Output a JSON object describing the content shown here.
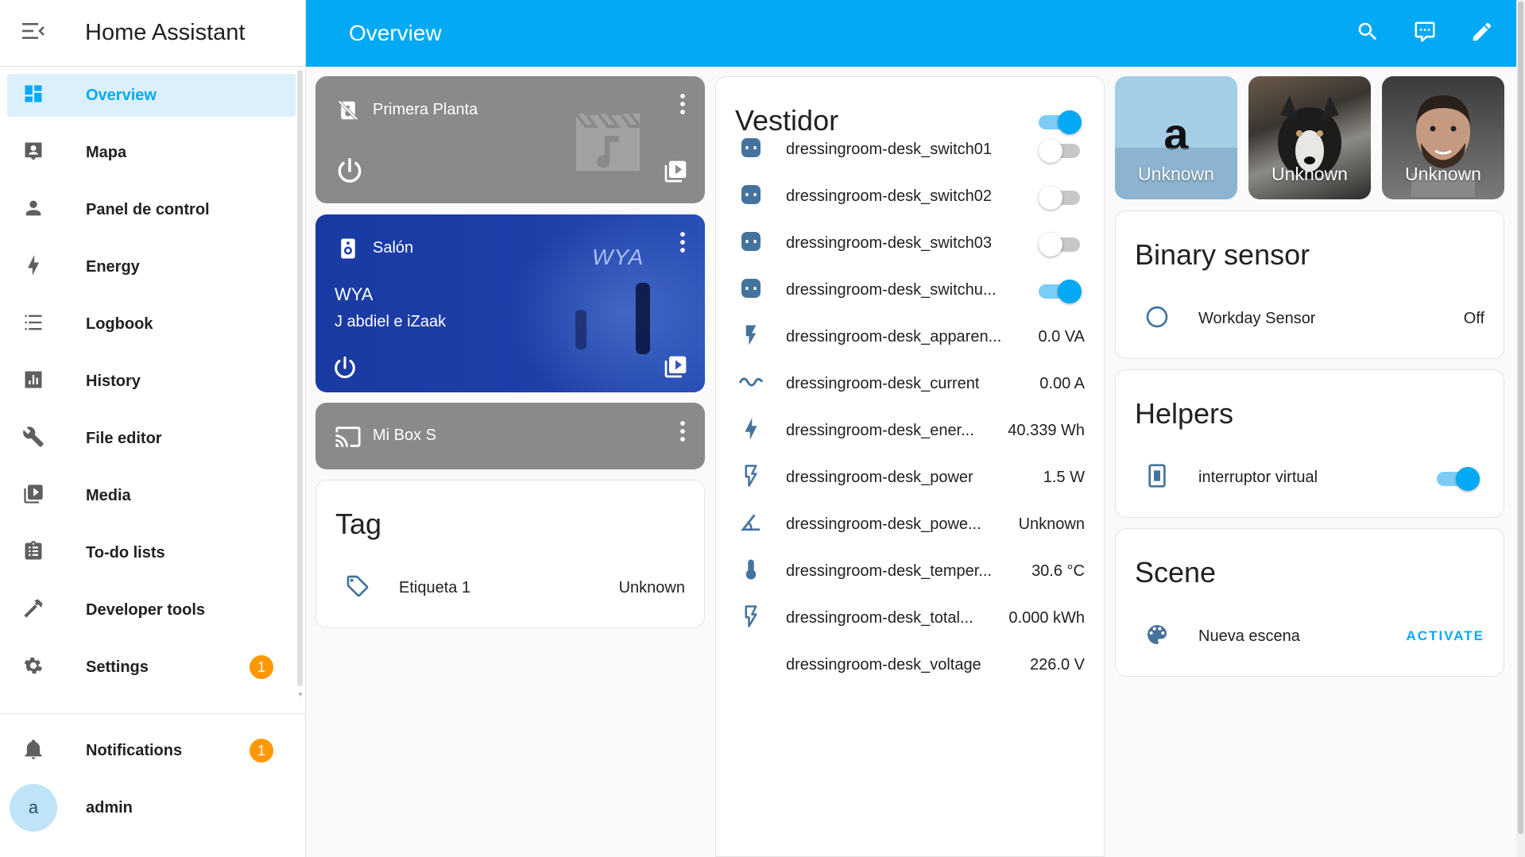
{
  "app": {
    "title": "Home Assistant"
  },
  "sidebar": {
    "items": [
      {
        "label": "Overview",
        "icon": "dashboard-icon"
      },
      {
        "label": "Mapa",
        "icon": "map-account-icon"
      },
      {
        "label": "Panel de control",
        "icon": "account-icon"
      },
      {
        "label": "Energy",
        "icon": "lightning-bolt-icon"
      },
      {
        "label": "Logbook",
        "icon": "list-icon"
      },
      {
        "label": "History",
        "icon": "chart-box-icon"
      },
      {
        "label": "File editor",
        "icon": "wrench-icon"
      },
      {
        "label": "Media",
        "icon": "play-box-multiple-icon"
      },
      {
        "label": "To-do lists",
        "icon": "clipboard-list-icon"
      },
      {
        "label": "Developer tools",
        "icon": "hammer-icon"
      },
      {
        "label": "Settings",
        "icon": "cog-icon",
        "badge": "1"
      }
    ],
    "notifications": {
      "label": "Notifications",
      "badge": "1"
    },
    "user": {
      "initial": "a",
      "name": "admin"
    }
  },
  "header": {
    "title": "Overview"
  },
  "media_players": [
    {
      "name": "Primera Planta"
    },
    {
      "name": "Salón",
      "track": "WYA",
      "artist": "J abdiel e iZaak",
      "art_text": "WYA"
    },
    {
      "name": "Mi Box S"
    }
  ],
  "tag_card": {
    "title": "Tag",
    "rows": [
      {
        "name": "Etiqueta 1",
        "state": "Unknown"
      }
    ]
  },
  "vestidor": {
    "title": "Vestidor",
    "master_on": true,
    "rows": [
      {
        "name": "dressingroom-desk_switch01",
        "type": "toggle",
        "on": false,
        "icon": "power-socket-icon"
      },
      {
        "name": "dressingroom-desk_switch02",
        "type": "toggle",
        "on": false,
        "icon": "power-socket-icon"
      },
      {
        "name": "dressingroom-desk_switch03",
        "type": "toggle",
        "on": false,
        "icon": "power-socket-icon"
      },
      {
        "name": "dressingroom-desk_switchu...",
        "type": "toggle",
        "on": true,
        "icon": "power-socket-icon"
      },
      {
        "name": "dressingroom-desk_apparen...",
        "value": "0.0 VA",
        "icon": "flash-icon"
      },
      {
        "name": "dressingroom-desk_current",
        "value": "0.00 A",
        "icon": "current-ac-icon"
      },
      {
        "name": "dressingroom-desk_ener...",
        "value": "40.339 Wh",
        "icon": "lightning-bolt-icon"
      },
      {
        "name": "dressingroom-desk_power",
        "value": "1.5 W",
        "icon": "flash-outline-icon"
      },
      {
        "name": "dressingroom-desk_powe...",
        "value": "Unknown",
        "icon": "angle-acute-icon"
      },
      {
        "name": "dressingroom-desk_temper...",
        "value": "30.6 °C",
        "icon": "thermometer-icon"
      },
      {
        "name": "dressingroom-desk_total...",
        "value": "0.000 kWh",
        "icon": "flash-outline-icon"
      },
      {
        "name": "dressingroom-desk_voltage",
        "value": "226.0 V",
        "icon": ""
      }
    ]
  },
  "persons": [
    {
      "initial": "a",
      "state": "Unknown"
    },
    {
      "state": "Unknown"
    },
    {
      "state": "Unknown"
    }
  ],
  "binary_sensor": {
    "title": "Binary sensor",
    "rows": [
      {
        "name": "Workday Sensor",
        "state": "Off"
      }
    ]
  },
  "helpers": {
    "title": "Helpers",
    "rows": [
      {
        "name": "interruptor virtual",
        "on": true
      }
    ]
  },
  "scene": {
    "title": "Scene",
    "rows": [
      {
        "name": "Nueva escena",
        "action": "ACTIVATE"
      }
    ]
  },
  "colors": {
    "primary": "#03a9f4",
    "icon": "#44739e",
    "badge": "#ff9800",
    "salon_bg": "#1a3fa8"
  }
}
